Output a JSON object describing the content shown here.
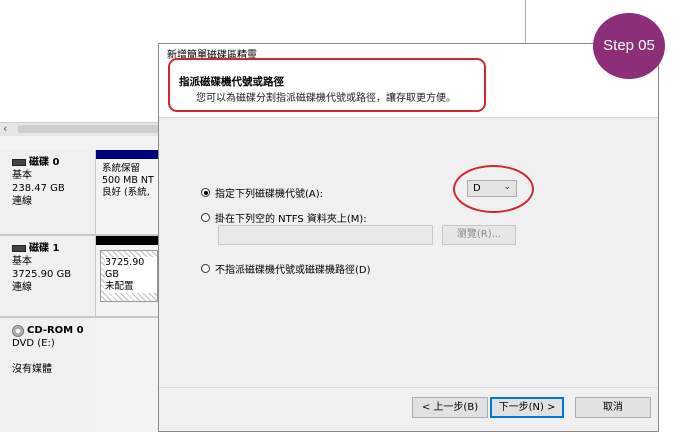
{
  "disks": [
    {
      "name": "磁碟 0",
      "type": "基本",
      "size": "238.47 GB",
      "status": "連線",
      "partition": {
        "name": "系統保留",
        "size": "500 MB NT",
        "status": "良好 (系統,",
        "bar_color": "#00007a"
      }
    },
    {
      "name": "磁碟 1",
      "type": "基本",
      "size": "3725.90 GB",
      "status": "連線",
      "partition": {
        "size": "3725.90 GB",
        "status": "未配置",
        "bar_color": "#000000"
      }
    },
    {
      "name": "CD-ROM 0",
      "type": "DVD (E:)",
      "status": "沒有媒體"
    }
  ],
  "wizard": {
    "title": "新增簡單磁碟區精靈",
    "heading": "指派磁碟機代號或路徑",
    "subheading": "您可以為磁碟分割指派磁碟機代號或路徑，讓存取更方便。",
    "options": [
      {
        "label": "指定下列磁碟機代號(A):",
        "checked": true
      },
      {
        "label": "掛在下列空的 NTFS 資料夾上(M):",
        "checked": false
      },
      {
        "label": "不指派磁碟機代號或磁碟機路徑(D)",
        "checked": false
      }
    ],
    "drive_letter": "D",
    "path_value": "",
    "browse_label": "瀏覽(R)...",
    "buttons": {
      "back": "< 上一步(B)",
      "next": "下一步(N) >",
      "cancel": "取消"
    }
  },
  "step_badge": "Step 05",
  "colors": {
    "highlight_red": "#d32630",
    "badge": "#8c2e78",
    "accent": "#0078d7"
  }
}
